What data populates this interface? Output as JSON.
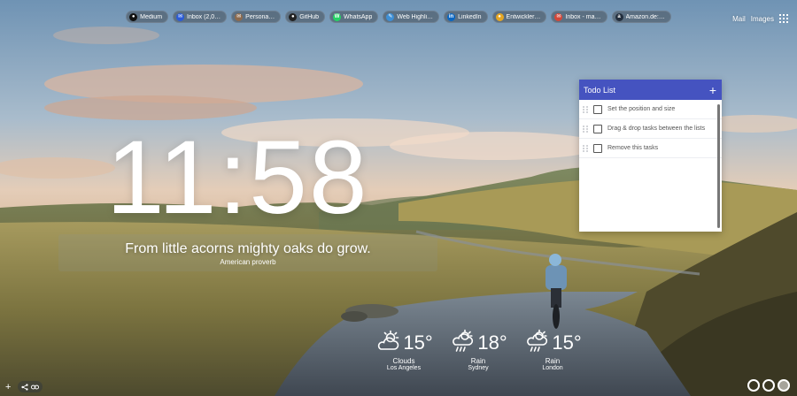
{
  "bookmarks": [
    {
      "label": "Medium",
      "icon": "medium-icon",
      "color": "#111111",
      "glyph": "●"
    },
    {
      "label": "Inbox (2,0…",
      "icon": "inbox-icon",
      "color": "#2b5bd7",
      "glyph": "✉"
    },
    {
      "label": "Persona…",
      "icon": "persona-icon",
      "color": "#8c6a4e",
      "glyph": "✉"
    },
    {
      "label": "GitHub",
      "icon": "github-icon",
      "color": "#222222",
      "glyph": "●"
    },
    {
      "label": "WhatsApp",
      "icon": "whatsapp-icon",
      "color": "#25d366",
      "glyph": "W"
    },
    {
      "label": "Web Highli…",
      "icon": "web-highlight-icon",
      "color": "#3d8fd6",
      "glyph": "✎"
    },
    {
      "label": "LinkedIn",
      "icon": "linkedin-icon",
      "color": "#0a66c2",
      "glyph": "in"
    },
    {
      "label": "Entwickler…",
      "icon": "chrome-icon",
      "color": "#e5a623",
      "glyph": "●"
    },
    {
      "label": "Inbox - ma…",
      "icon": "inbox-icon",
      "color": "#d44638",
      "glyph": "✉"
    },
    {
      "label": "Amazon.de:…",
      "icon": "amazon-icon",
      "color": "#232f3e",
      "glyph": "a"
    }
  ],
  "top_right": {
    "mail": "Mail",
    "images": "Images"
  },
  "clock": {
    "time": "11:58"
  },
  "quote": {
    "text": "From little acorns mighty oaks do grow.",
    "author": "American proverb"
  },
  "todo": {
    "title": "Todo List",
    "add": "+",
    "items": [
      {
        "text": "Set the position and size"
      },
      {
        "text": "Drag & drop tasks between the lists"
      },
      {
        "text": "Remove this tasks"
      }
    ]
  },
  "weather": [
    {
      "temp": "15°",
      "condition": "Clouds",
      "city": "Los Angeles",
      "icon": "cloud-sun-icon"
    },
    {
      "temp": "18°",
      "condition": "Rain",
      "city": "Sydney",
      "icon": "rain-sun-icon"
    },
    {
      "temp": "15°",
      "condition": "Rain",
      "city": "London",
      "icon": "rain-sun-icon"
    }
  ],
  "bottom": {
    "add": "+"
  }
}
